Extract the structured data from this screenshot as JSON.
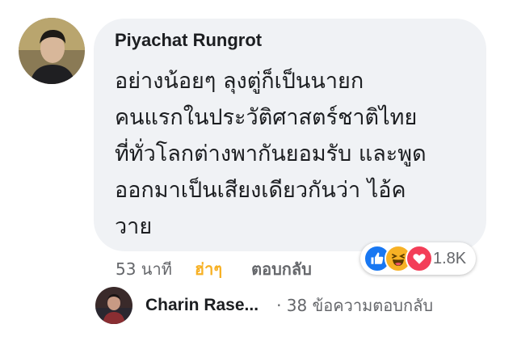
{
  "comment": {
    "author": "Piyachat Rungrot",
    "lines": [
      "อย่างน้อยๆ ลุงตู่ก็เป็นนายก",
      "คนแรกในประวัติศาสตร์ชาติไทย",
      "ที่ทั่วโลกต่างพากันยอมรับ และพูด",
      "ออกมาเป็นเสียงเดียวกันว่า ไอ้ค",
      "วาย"
    ],
    "time": "53 นาที",
    "reaction_label": "ฮ่าๆ",
    "reply_label": "ตอบกลับ",
    "reactions": {
      "icons": [
        "like-icon",
        "haha-icon",
        "love-icon"
      ],
      "count": "1.8K"
    }
  },
  "replies": {
    "author": "Charin Rase...",
    "count_text": "· 38 ข้อความตอบกลับ"
  },
  "colors": {
    "bubble": "#f0f2f5",
    "like": "#1877f2",
    "haha": "#f7b125",
    "love": "#f33e58"
  }
}
